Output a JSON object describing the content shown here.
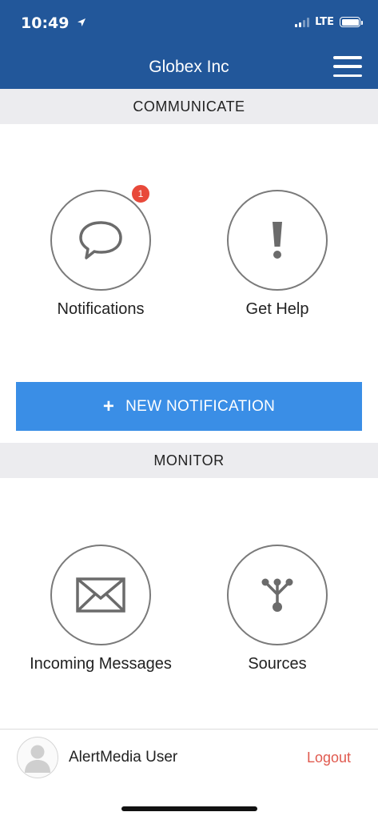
{
  "status_bar": {
    "time": "10:49",
    "network": "LTE"
  },
  "header": {
    "title": "Globex Inc"
  },
  "communicate": {
    "section_title": "COMMUNICATE",
    "tiles": [
      {
        "label": "Notifications",
        "icon": "speech-bubble-icon",
        "badge": "1"
      },
      {
        "label": "Get Help",
        "icon": "exclamation-icon"
      }
    ],
    "new_button_label": "NEW NOTIFICATION"
  },
  "monitor": {
    "section_title": "MONITOR",
    "tiles": [
      {
        "label": "Incoming Messages",
        "icon": "envelope-icon"
      },
      {
        "label": "Sources",
        "icon": "sources-icon"
      }
    ]
  },
  "footer": {
    "user_name": "AlertMedia User",
    "logout_label": "Logout"
  },
  "colors": {
    "header": "#22579a",
    "button": "#3a8ee6",
    "badge": "#e8493a",
    "logout": "#e05a4f",
    "section_bg": "#ececef"
  }
}
